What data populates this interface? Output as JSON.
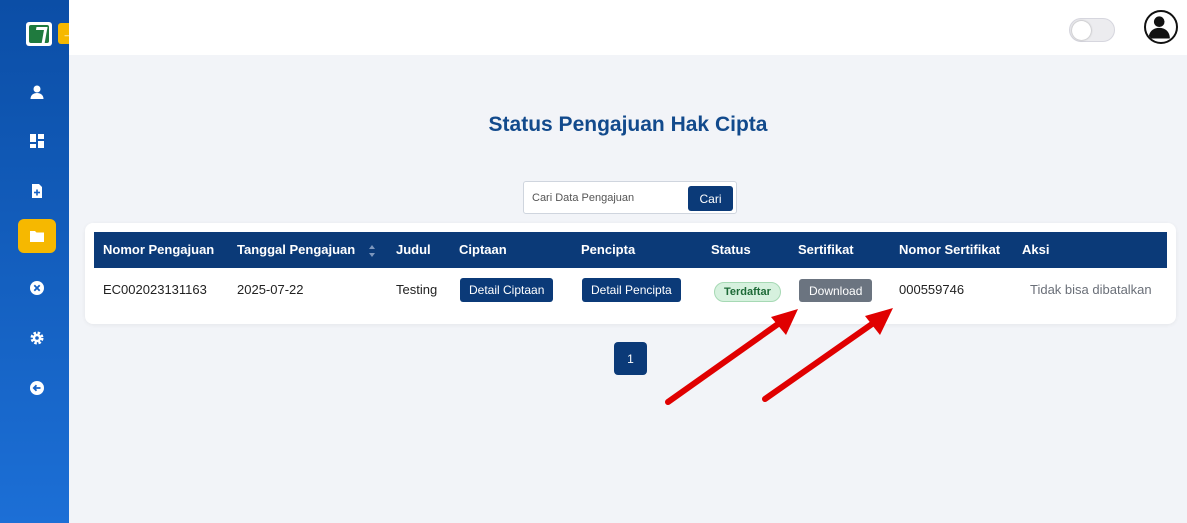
{
  "topbar": {
    "sidebar_toggle_icon": "arrow-right-icon",
    "theme_switch": "off"
  },
  "sidebar": {
    "items": [
      {
        "icon": "user-icon",
        "active": false
      },
      {
        "icon": "dashboard-icon",
        "active": false
      },
      {
        "icon": "file-add-icon",
        "active": false
      },
      {
        "icon": "folder-icon",
        "active": true
      },
      {
        "icon": "close-circle-icon",
        "active": false
      },
      {
        "icon": "gear-icon",
        "active": false
      },
      {
        "icon": "logout-icon",
        "active": false
      }
    ]
  },
  "page": {
    "title": "Status Pengajuan Hak Cipta"
  },
  "search": {
    "placeholder": "Cari Data Pengajuan",
    "value": "",
    "button_label": "Cari"
  },
  "table": {
    "headers": [
      "Nomor Pengajuan",
      "Tanggal Pengajuan",
      "Judul",
      "Ciptaan",
      "Pencipta",
      "Status",
      "Sertifikat",
      "Nomor Sertifikat",
      "Aksi"
    ],
    "rows": [
      {
        "nomor_pengajuan": "EC002023131163",
        "tanggal_pengajuan": "2025-07-22",
        "judul": "Testing",
        "ciptaan_button": "Detail Ciptaan",
        "pencipta_button": "Detail Pencipta",
        "status": "Terdaftar",
        "sertifikat_button": "Download",
        "nomor_sertifikat": "000559746",
        "aksi": "Tidak bisa dibatalkan"
      }
    ]
  },
  "pagination": {
    "current_page": "1"
  },
  "colors": {
    "primary": "#0b3a78",
    "sidebar": "#1c6fd6",
    "accent": "#f6b800",
    "annotation_arrow": "#e00000",
    "status_badge": "#d6f1de"
  }
}
